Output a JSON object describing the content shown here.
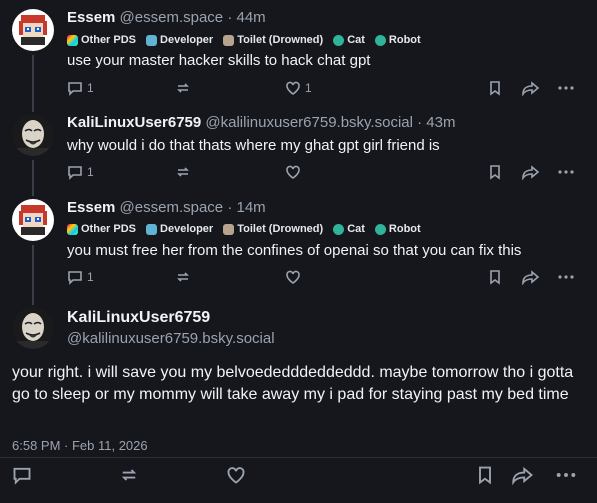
{
  "posts": [
    {
      "name": "Essem",
      "handle": "@essem.space",
      "time": "44m",
      "badges": [
        "Other PDS",
        "Developer",
        "Toilet (Drowned)",
        "Cat",
        "Robot"
      ],
      "text": "use your master hacker skills to hack chat gpt",
      "reply_count": "1",
      "like_count": "1"
    },
    {
      "name": "KaliLinuxUser6759",
      "handle": "@kalilinuxuser6759.bsky.social",
      "time": "43m",
      "text": "why would i do that thats where my ghat gpt girl friend is",
      "reply_count": "1",
      "like_count": ""
    },
    {
      "name": "Essem",
      "handle": "@essem.space",
      "time": "14m",
      "badges": [
        "Other PDS",
        "Developer",
        "Toilet (Drowned)",
        "Cat",
        "Robot"
      ],
      "text": "you must free her from the confines of openai so that you can fix this",
      "reply_count": "1",
      "like_count": ""
    }
  ],
  "main": {
    "name": "KaliLinuxUser6759",
    "handle": "@kalilinuxuser6759.bsky.social",
    "text": "your right. i will save you my belvoededddeddeddd. maybe tomorrow tho i gotta go to sleep or my mommy will take away my i pad for staying past my bed time",
    "date": "6:58 PM · Feb 11, 2026"
  },
  "dot": "·"
}
